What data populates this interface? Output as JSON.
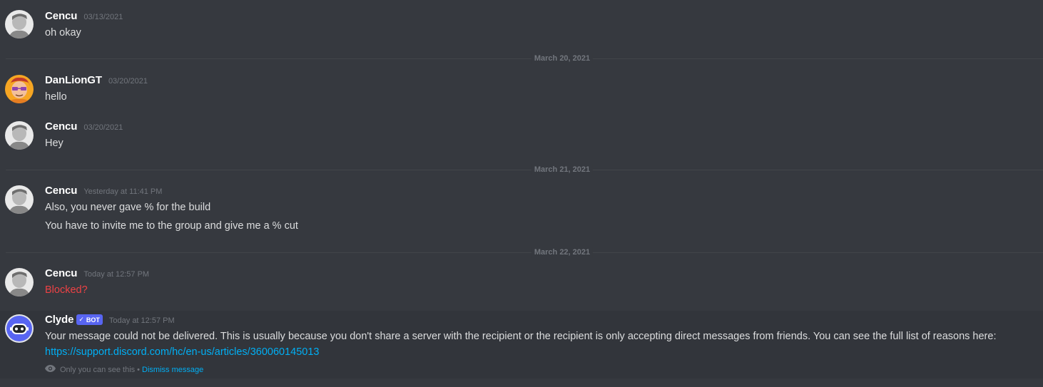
{
  "messages": [
    {
      "author": "Cencu",
      "timestamp": "03/13/2021",
      "lines": [
        "oh okay"
      ]
    },
    {
      "author": "DanLionGT",
      "timestamp": "03/20/2021",
      "lines": [
        "hello"
      ]
    },
    {
      "author": "Cencu",
      "timestamp": "03/20/2021",
      "lines": [
        "Hey"
      ]
    },
    {
      "author": "Cencu",
      "timestamp": "Yesterday at 11:41 PM",
      "lines": [
        "Also, you never gave % for the build",
        "You have to invite me to the group and give me a % cut"
      ]
    },
    {
      "author": "Cencu",
      "timestamp": "Today at 12:57 PM",
      "lines": [
        "Blocked?"
      ]
    }
  ],
  "dividers": [
    "March 20, 2021",
    "March 21, 2021",
    "March 22, 2021"
  ],
  "bot_message": {
    "author": "Clyde",
    "badge": "BOT",
    "timestamp": "Today at 12:57 PM",
    "text": "Your message could not be delivered. This is usually because you don't share a server with the recipient or the recipient is only accepting direct messages from friends. You can see the full list of reasons here:",
    "link": "https://support.discord.com/hc/en-us/articles/360060145013",
    "ephemeral_note": "Only you can see this",
    "separator": "•",
    "dismiss_label": "Dismiss message"
  },
  "colors": {
    "background": "#36393f",
    "error_text": "#ed4245",
    "link": "#00aff4",
    "bot_badge": "#5865f2"
  },
  "icons": {
    "verified_check": "✓",
    "eye": "eye-icon"
  }
}
